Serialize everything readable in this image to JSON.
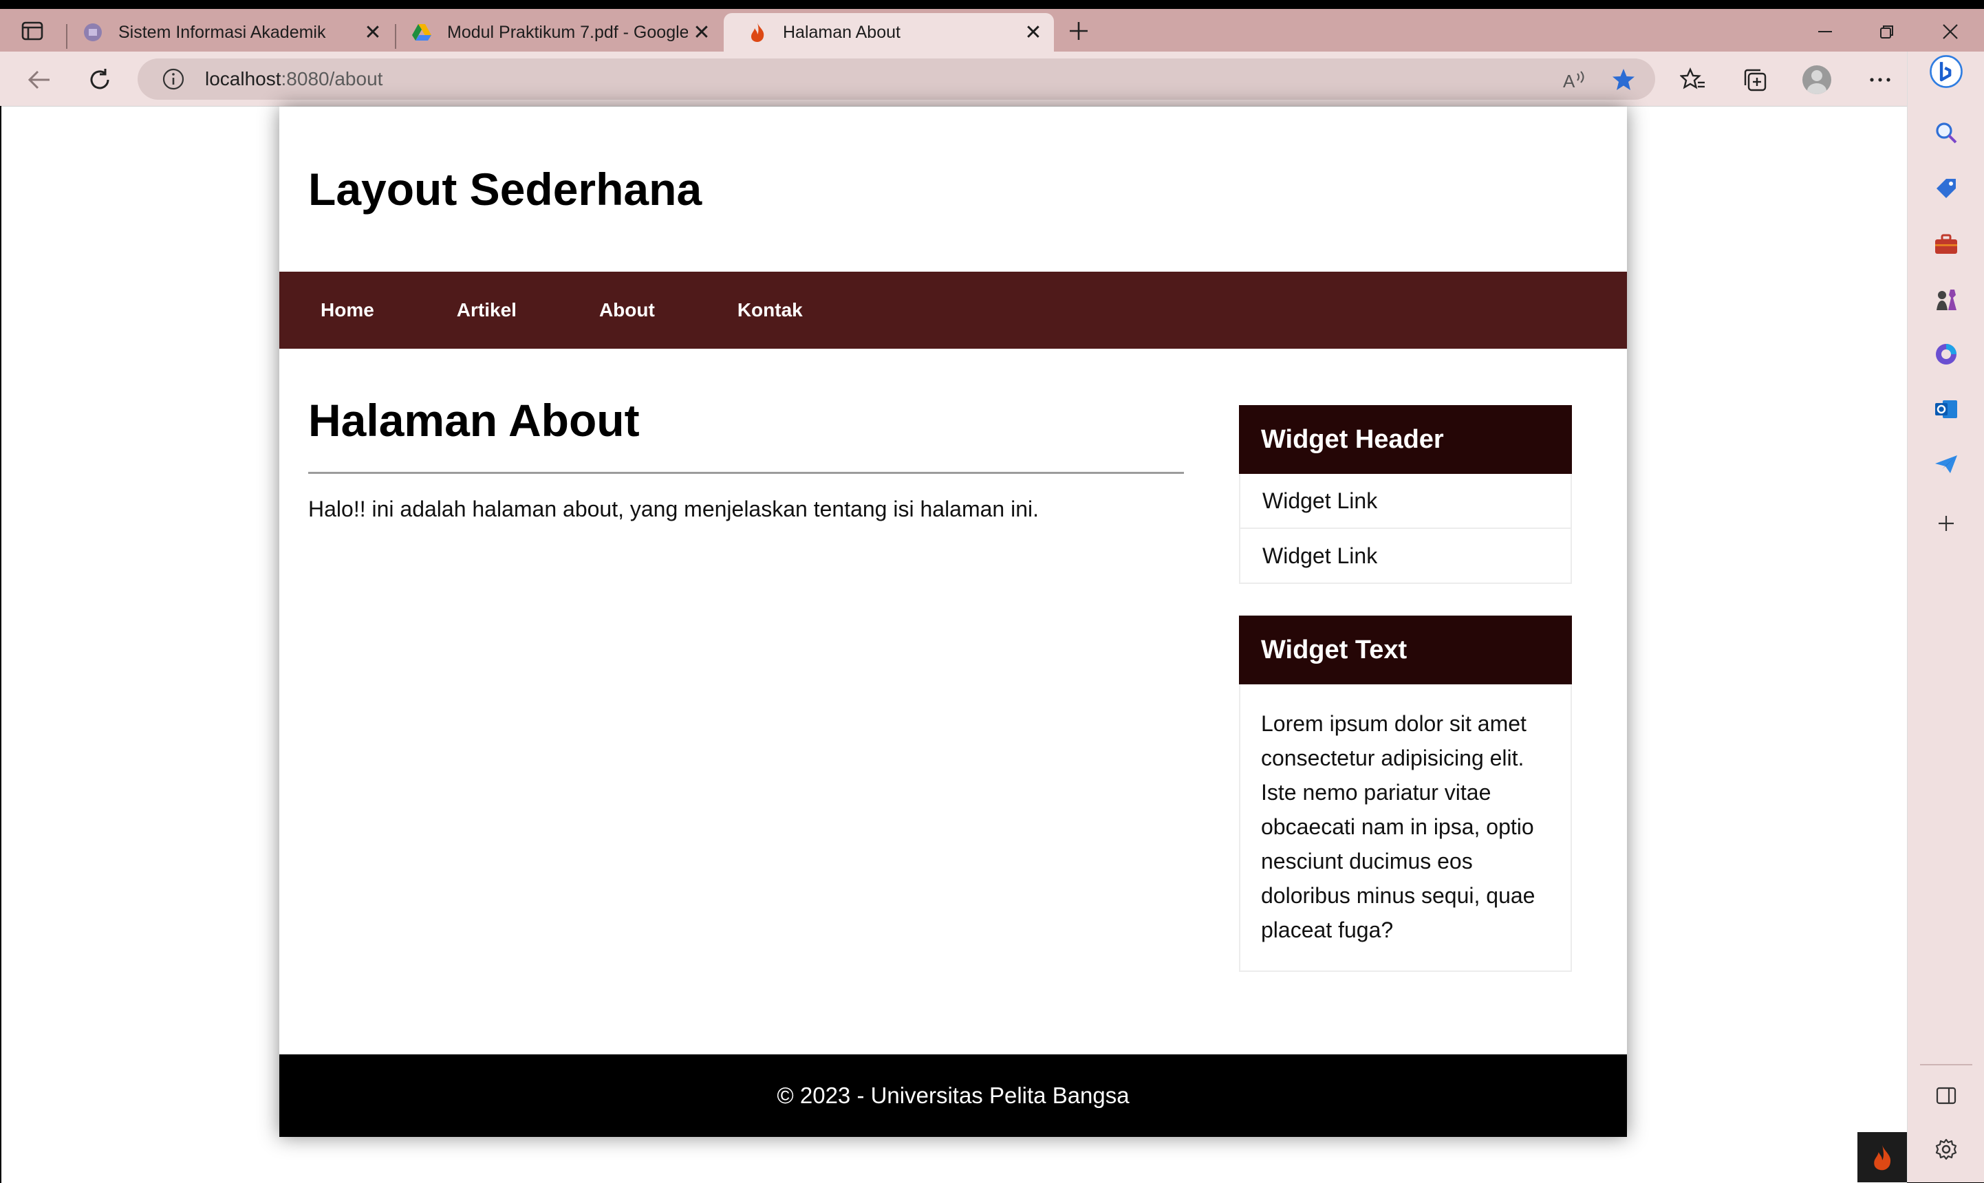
{
  "browser": {
    "tabs": [
      {
        "title": "Sistem Informasi Akademik",
        "favicon": "academic-icon"
      },
      {
        "title": "Modul Praktikum 7.pdf - Google",
        "favicon": "google-drive-icon"
      },
      {
        "title": "Halaman About",
        "favicon": "codeigniter-icon"
      }
    ],
    "url_host": "localhost",
    "url_path": ":8080/about"
  },
  "site": {
    "title": "Layout Sederhana",
    "nav": [
      "Home",
      "Artikel",
      "About",
      "Kontak"
    ],
    "nav_color": "#4f1a1a"
  },
  "content": {
    "heading": "Halaman About",
    "paragraph": "Halo!! ini adalah halaman about, yang menjelaskan tentang isi halaman ini."
  },
  "sidebar": {
    "widget_header": {
      "title": "Widget Header",
      "links": [
        "Widget Link",
        "Widget Link"
      ]
    },
    "widget_text": {
      "title": "Widget Text",
      "body": "Lorem ipsum dolor sit amet consectetur adipisicing elit. Iste nemo pariatur vitae obcaecati nam in ipsa, optio nesciunt ducimus eos doloribus minus sequi, quae placeat fuga?"
    },
    "header_color": "#250606"
  },
  "footer": {
    "text": "© 2023 - Universitas Pelita Bangsa"
  }
}
